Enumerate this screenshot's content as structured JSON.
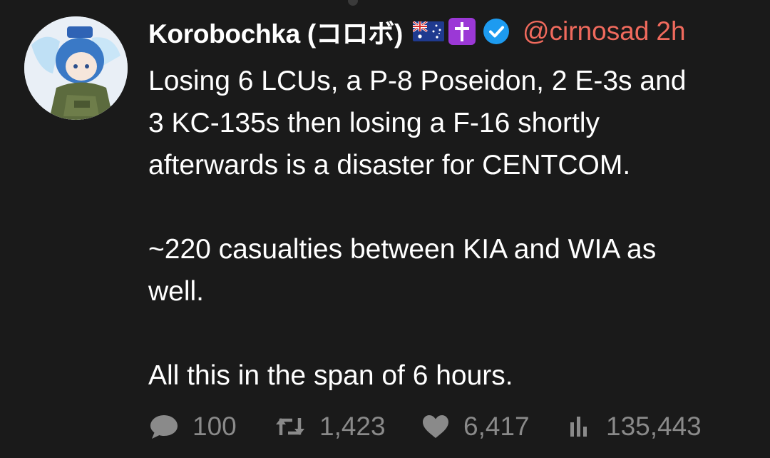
{
  "post": {
    "author": {
      "display_name": "Korobochka (コロボ)",
      "handle": "@cirnosad",
      "verified": true,
      "badges": [
        "australia-flag-icon",
        "latin-cross-icon"
      ]
    },
    "time": "2h",
    "text": {
      "p1_l1": "Losing 6 LCUs, a P-8 Poseidon, 2 E-3s and",
      "p1_l2": "3 KC-135s then losing a F-16 shortly",
      "p1_l3": "afterwards is a disaster for CENTCOM.",
      "p2_l1": "~220 casualties between KIA and WIA as",
      "p2_l2": "well.",
      "p3_l1": "All this in the span of 6 hours."
    },
    "stats": {
      "replies": "100",
      "reposts": "1,423",
      "likes": "6,417",
      "views": "135,443"
    }
  },
  "colors": {
    "background": "#1a1a1a",
    "handle_accent": "#f06a5d",
    "verified_blue": "#1d9bf0",
    "muted": "#8a8a8a"
  }
}
